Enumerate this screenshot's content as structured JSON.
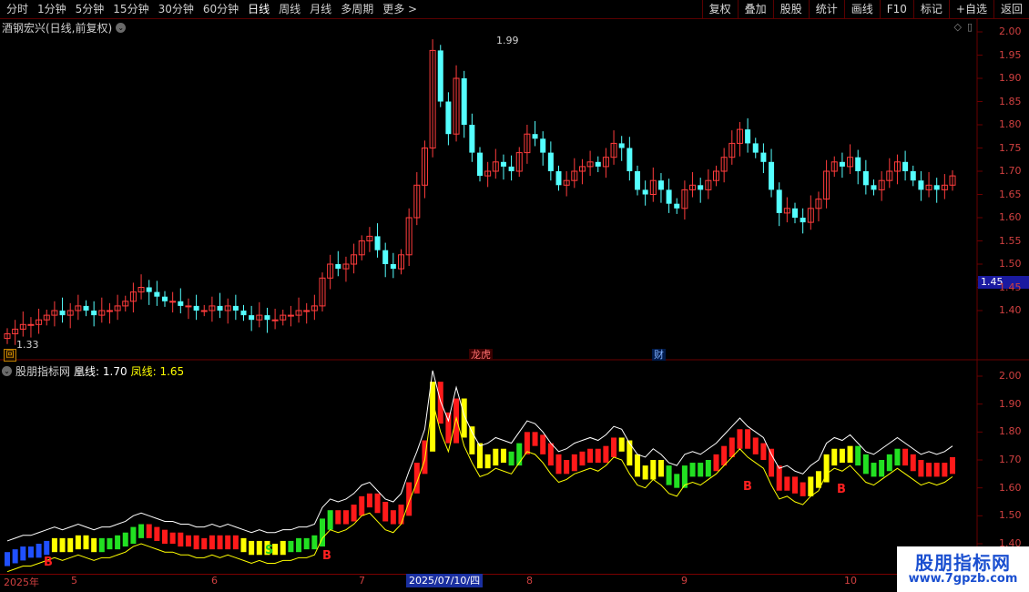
{
  "toolbar": {
    "periods": [
      "分时",
      "1分钟",
      "5分钟",
      "15分钟",
      "30分钟",
      "60分钟",
      "日线",
      "周线",
      "月线",
      "多周期",
      "更多 >"
    ],
    "active_index": 6,
    "right_buttons": [
      "复权",
      "叠加",
      "股股",
      "统计",
      "画线",
      "F10",
      "标记",
      "+自选",
      "返回"
    ]
  },
  "main_panel": {
    "title": "酒钢宏兴(日线,前复权)",
    "high_label": "1.99",
    "low_label": "1.33",
    "current_price": "1.45",
    "y_ticks": [
      "2.00",
      "1.95",
      "1.90",
      "1.85",
      "1.80",
      "1.75",
      "1.70",
      "1.65",
      "1.60",
      "1.55",
      "1.50",
      "1.45",
      "1.40"
    ],
    "events": [
      {
        "label": "龙虎",
        "type": "red"
      },
      {
        "label": "财",
        "type": "blue"
      }
    ],
    "hui_label": "回"
  },
  "indicator_panel": {
    "name": "股朋指标网",
    "huang_label": "凰线: 1.70",
    "feng_label": "凤线: 1.65",
    "y_ticks": [
      "2.00",
      "1.90",
      "1.80",
      "1.70",
      "1.60",
      "1.50",
      "1.40"
    ],
    "signals": [
      {
        "label": "B"
      },
      {
        "label": "S"
      },
      {
        "label": "B"
      },
      {
        "label": "B"
      },
      {
        "label": "B"
      }
    ]
  },
  "date_axis": {
    "labels": [
      "2025年",
      "5",
      "6",
      "7",
      "8",
      "9",
      "10"
    ],
    "selected": "2025/07/10/四"
  },
  "watermark": {
    "name": "股朋指标网",
    "url": "www.7gpzb.com"
  },
  "colors": {
    "up": "#ff3c3c",
    "down": "#54ffff",
    "grid": "#6a0000",
    "axis_text": "#d04040",
    "huang": "#ffffff",
    "feng": "#ffff00"
  },
  "chart_data": {
    "type": "candlestick",
    "close_series": [
      1.35,
      1.36,
      1.37,
      1.37,
      1.38,
      1.39,
      1.4,
      1.39,
      1.4,
      1.41,
      1.4,
      1.39,
      1.4,
      1.4,
      1.41,
      1.42,
      1.44,
      1.45,
      1.44,
      1.43,
      1.42,
      1.42,
      1.41,
      1.41,
      1.4,
      1.4,
      1.41,
      1.4,
      1.41,
      1.4,
      1.39,
      1.38,
      1.39,
      1.38,
      1.38,
      1.39,
      1.39,
      1.4,
      1.4,
      1.41,
      1.47,
      1.5,
      1.49,
      1.5,
      1.52,
      1.55,
      1.56,
      1.53,
      1.5,
      1.49,
      1.52,
      1.6,
      1.67,
      1.75,
      1.96,
      1.85,
      1.78,
      1.9,
      1.8,
      1.74,
      1.69,
      1.7,
      1.72,
      1.71,
      1.7,
      1.74,
      1.78,
      1.77,
      1.74,
      1.7,
      1.67,
      1.68,
      1.7,
      1.71,
      1.72,
      1.71,
      1.73,
      1.76,
      1.75,
      1.7,
      1.66,
      1.65,
      1.68,
      1.66,
      1.63,
      1.62,
      1.66,
      1.67,
      1.66,
      1.68,
      1.7,
      1.73,
      1.76,
      1.79,
      1.76,
      1.74,
      1.72,
      1.66,
      1.61,
      1.62,
      1.6,
      1.59,
      1.62,
      1.64,
      1.7,
      1.72,
      1.71,
      1.73,
      1.7,
      1.67,
      1.66,
      1.68,
      1.7,
      1.72,
      1.7,
      1.68,
      1.66,
      1.67,
      1.66,
      1.67,
      1.69
    ]
  }
}
